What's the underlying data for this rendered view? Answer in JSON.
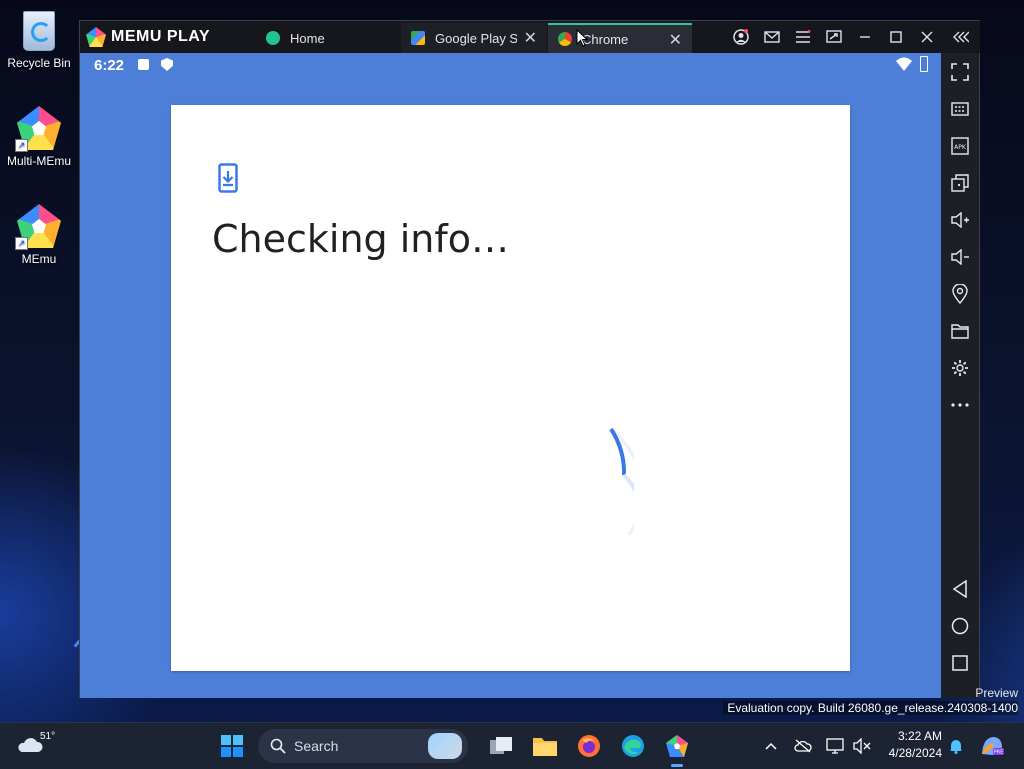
{
  "desktop": {
    "icons": [
      {
        "label": "Recycle Bin"
      },
      {
        "label": "Multi-MEmu"
      },
      {
        "label": "MEmu"
      }
    ]
  },
  "memu": {
    "brand": "MEMU PLAY",
    "tabs": [
      {
        "label": "Home"
      },
      {
        "label": "Google Play Store"
      },
      {
        "label": "Chrome"
      }
    ],
    "sidebar_icons": [
      "fullscreen-icon",
      "keyboard-icon",
      "apk-icon",
      "multi-window-icon",
      "volume-up-icon",
      "volume-down-icon",
      "location-icon",
      "folder-icon",
      "settings-icon",
      "more-icon",
      "back-icon",
      "home-icon",
      "recents-icon"
    ]
  },
  "android": {
    "time": "6:22",
    "dialog_title": "Checking info…"
  },
  "overlay": {
    "preview": "Preview",
    "evaluation": "Evaluation copy. Build 26080.ge_release.240308-1400"
  },
  "taskbar": {
    "weather_temp": "51°",
    "search_placeholder": "Search",
    "clock_time": "3:22 AM",
    "clock_date": "4/28/2024"
  },
  "colors": {
    "android_bg": "#4d7fd9",
    "accent_tab": "#31c4a5",
    "spinner": "#3b78e7"
  }
}
